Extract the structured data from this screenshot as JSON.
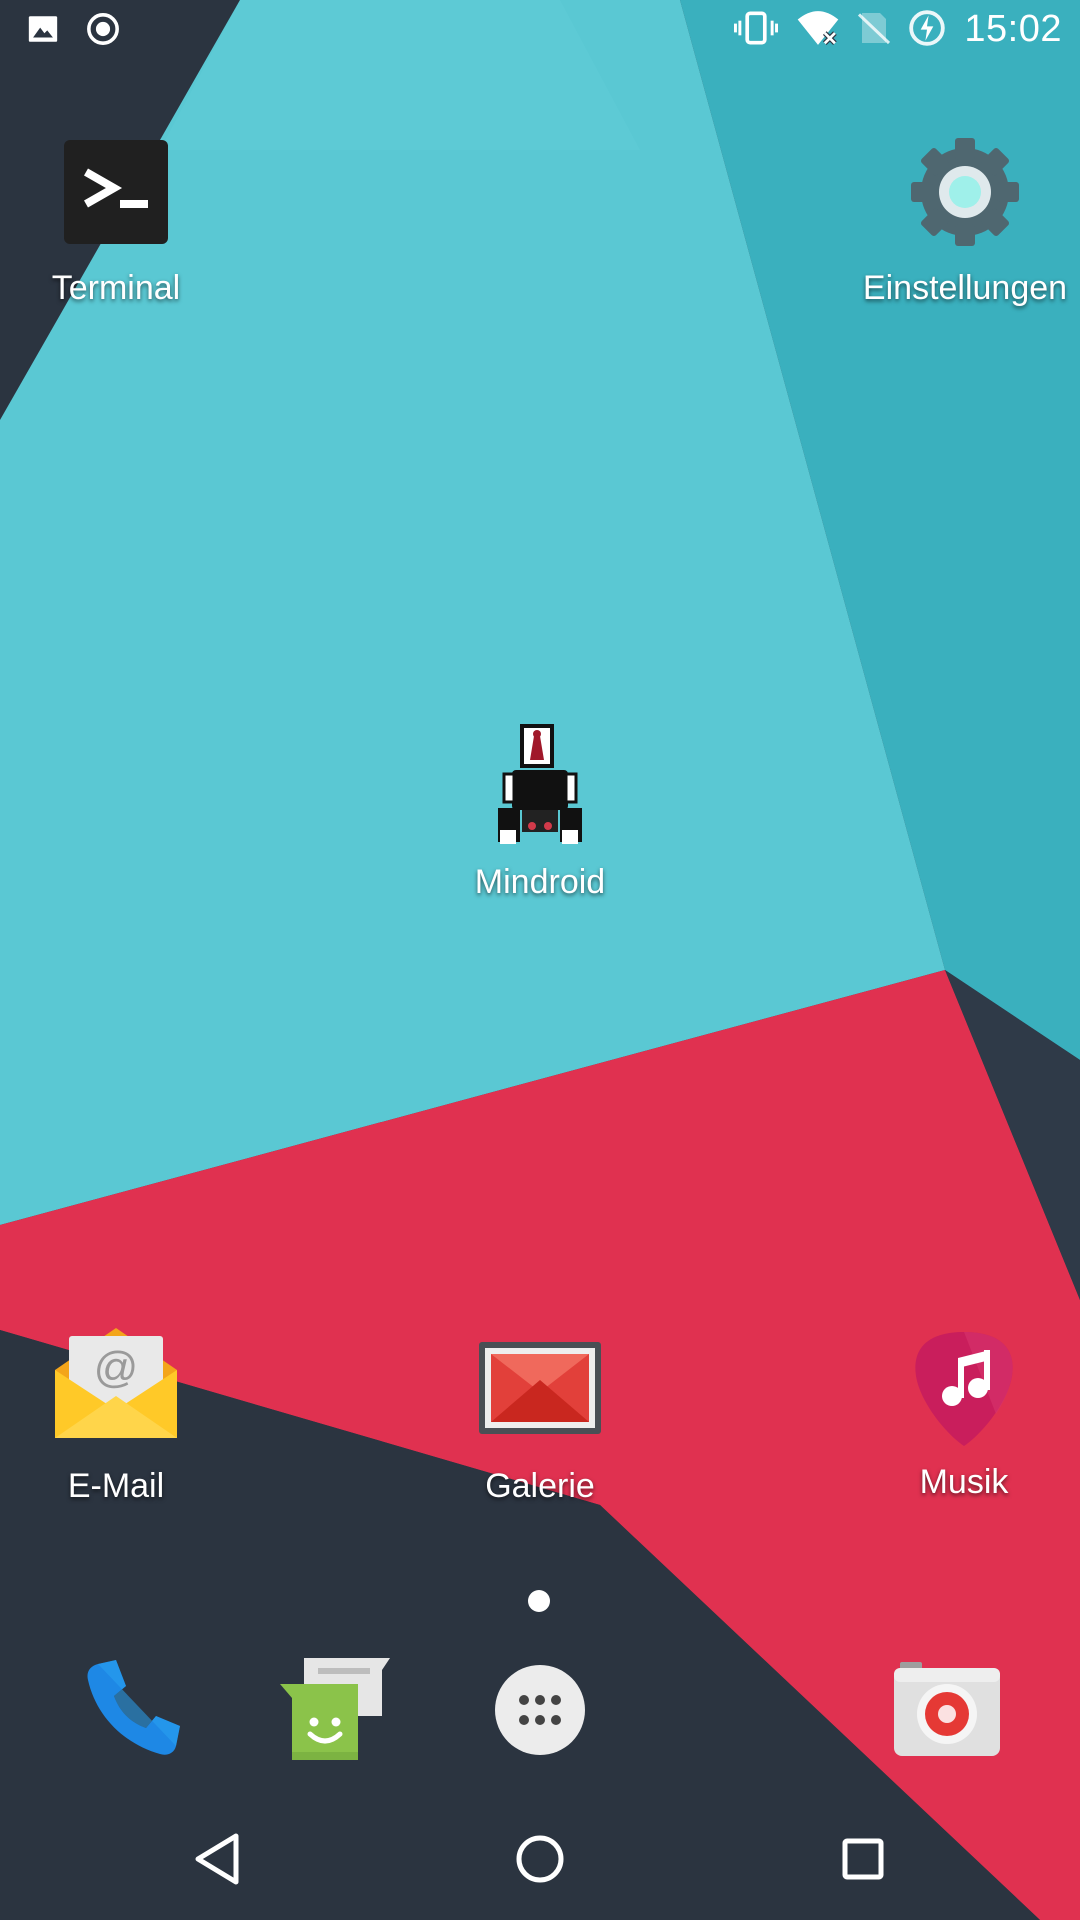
{
  "status": {
    "time": "15:02",
    "left_icons": [
      "image-icon",
      "record-icon"
    ],
    "right_icons": [
      "vibrate-icon",
      "wifi-no-internet-icon",
      "no-sim-icon",
      "battery-charging-icon"
    ]
  },
  "apps": {
    "terminal": {
      "label": "Terminal"
    },
    "settings": {
      "label": "Einstellungen"
    },
    "mindroid": {
      "label": "Mindroid"
    },
    "email": {
      "label": "E-Mail"
    },
    "gallery": {
      "label": "Galerie"
    },
    "music": {
      "label": "Musik"
    }
  },
  "dock": [
    "phone-icon",
    "messaging-icon",
    "app-drawer-icon",
    "camera-icon"
  ],
  "navbar": [
    "back-icon",
    "home-icon",
    "recents-icon"
  ],
  "colors": {
    "teal": "#5bc6d2",
    "red": "#e03150",
    "dark": "#2b3440"
  }
}
